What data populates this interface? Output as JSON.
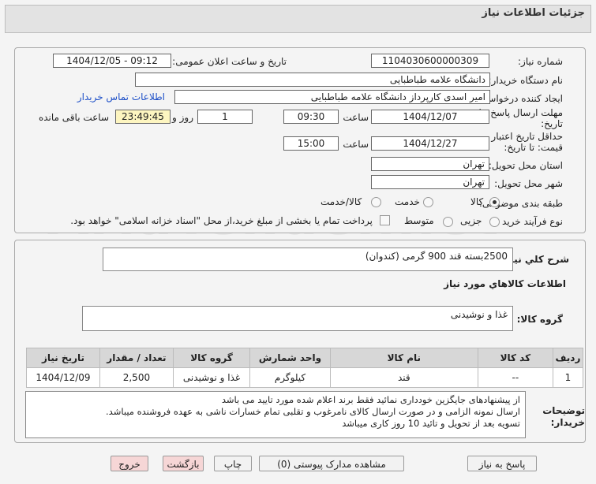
{
  "header": {
    "title": "جزئیات اطلاعات نیاز"
  },
  "watermark": "AriaTender.net",
  "fields": {
    "need_number_label": "شماره نیاز:",
    "need_number": "1104030600000309",
    "announce_label": "تاریخ و ساعت اعلان عمومی:",
    "announce_value": "1404/12/05 - 09:12",
    "buyer_org_label": "نام دستگاه خریدار:",
    "buyer_org": "دانشگاه علامه طباطبایی",
    "creator_label": "ایجاد کننده درخواست:",
    "creator": "امیر اسدی کارپرداز دانشگاه علامه طباطبایی",
    "contact_link": "اطلاعات تماس خریدار",
    "reply_deadline_label": "مهلت ارسال پاسخ: تا تاریخ:",
    "reply_date": "1404/12/07",
    "time_label": "ساعت",
    "reply_time": "09:30",
    "days_value": "1",
    "days_label": "روز و",
    "remaining_time": "23:49:45",
    "remaining_label": "ساعت باقی مانده",
    "validity_label": "حداقل تاریخ اعتبار قیمت: تا تاریخ:",
    "validity_date": "1404/12/27",
    "validity_time": "15:00",
    "province_label": "استان محل تحویل:",
    "province": "تهران",
    "city_label": "شهر محل تحویل:",
    "city": "تهران",
    "category_label": "طبقه بندی موضوعی:",
    "category_options": [
      "کالا",
      "خدمت",
      "کالا/خدمت"
    ],
    "process_label": "نوع فرآیند خرید :",
    "process_options": [
      "جزیی",
      "متوسط"
    ],
    "payment_note": "پرداخت تمام یا بخشی از مبلغ خرید،از محل \"اسناد خزانه اسلامی\" خواهد بود."
  },
  "summary": {
    "label": "شرح کلي نياز:",
    "value": "2500بسته قند 900 گرمی (کندوان)"
  },
  "goods_info_title": "اطلاعات کالاهاي مورد نياز",
  "goods_group": {
    "label": "گروه کالا:",
    "value": "غذا و نوشیدنی"
  },
  "table": {
    "headers": [
      "ردیف",
      "کد کالا",
      "نام کالا",
      "واحد شمارش",
      "گروه کالا",
      "تعداد / مقدار",
      "تاریخ نیاز"
    ],
    "rows": [
      [
        "1",
        "--",
        "قند",
        "کیلوگرم",
        "غذا و نوشیدنی",
        "2,500",
        "1404/12/09"
      ]
    ]
  },
  "buyer_notes": {
    "label": "توضیحات خریدار:",
    "lines": [
      "از پیشنهادهای جایگزین خودداری نمائید فقط برند اعلام شده مورد تایید می باشد",
      "ارسال نمونه الزامی و در صورت ارسال کالای نامرغوب و تقلبی تمام خسارات ناشی به عهده فروشنده میباشد.",
      "تسویه بعد از تحویل و تائید 10 روز کاری میباشد"
    ]
  },
  "buttons": {
    "reply": "پاسخ به نیاز",
    "view_docs": "مشاهده مدارک پیوستی (0)",
    "print": "چاپ",
    "back": "بازگشت",
    "exit": "خروج"
  }
}
